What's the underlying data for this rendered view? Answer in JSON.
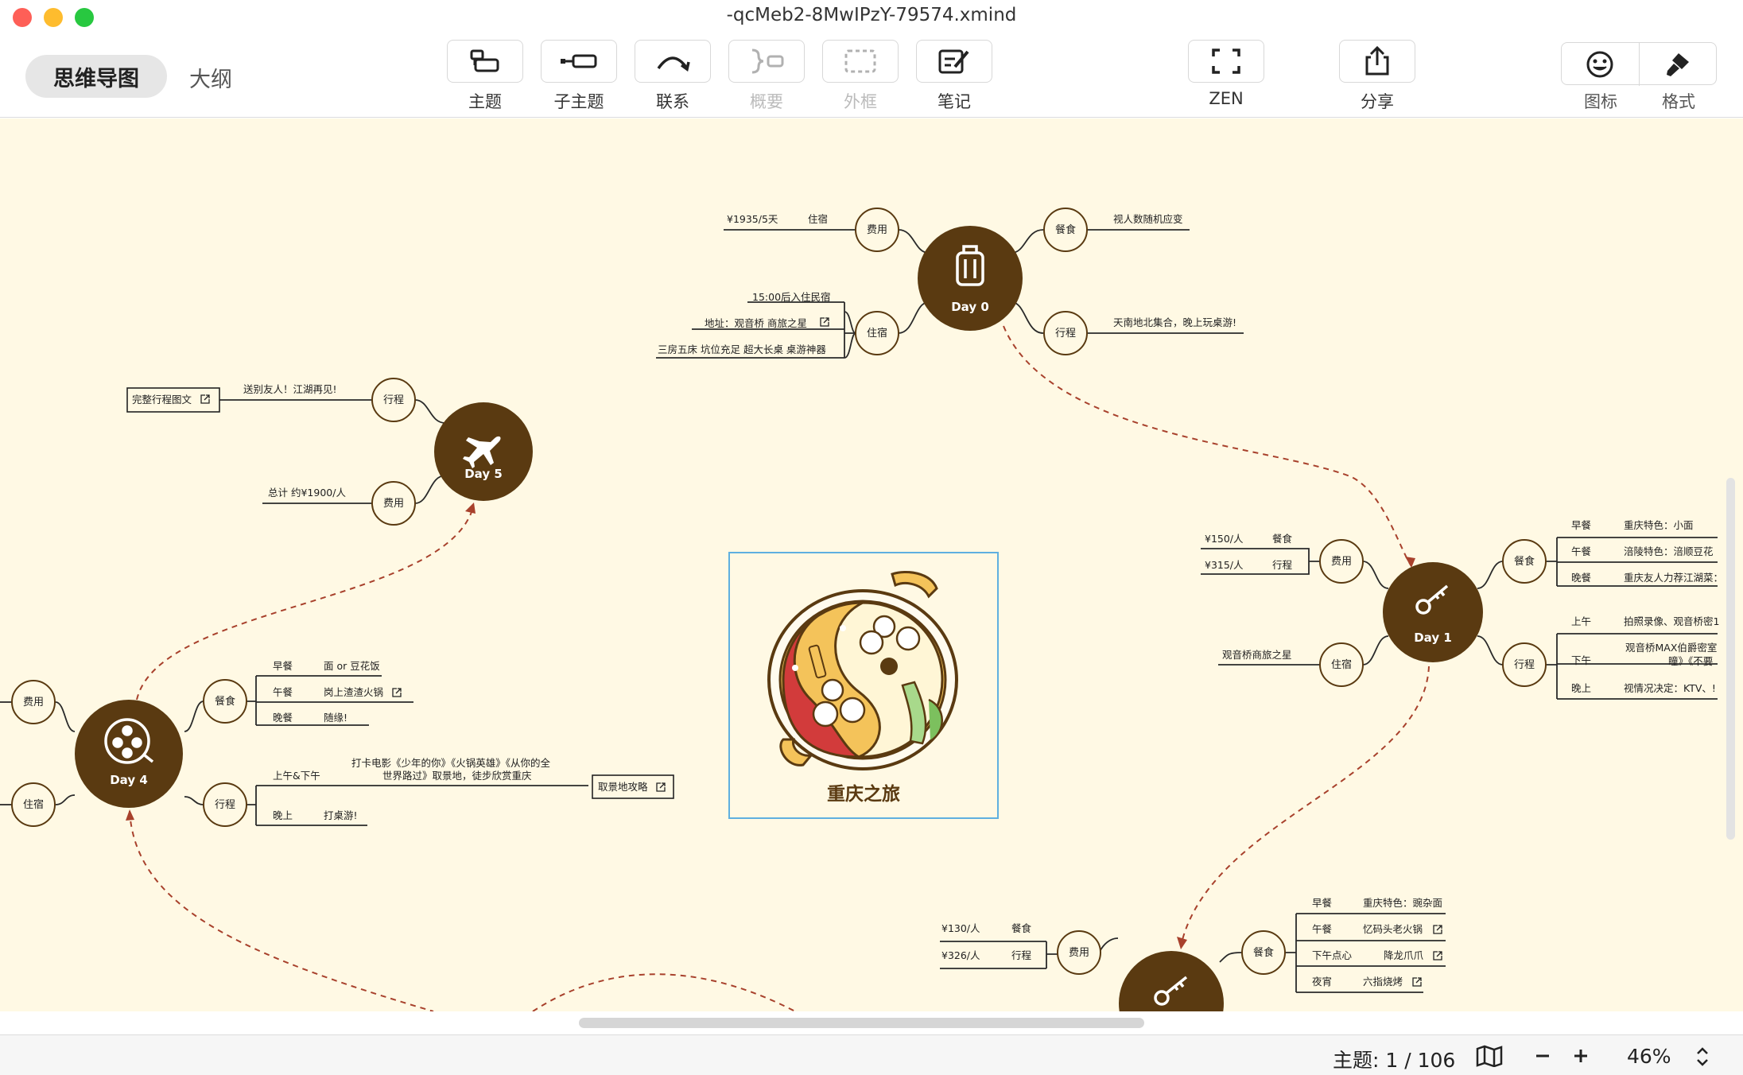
{
  "window": {
    "title": "-qcMeb2-8MwIPzY-79574.xmind"
  },
  "view_switch": {
    "mindmap": "思维导图",
    "outline": "大纲"
  },
  "toolbar": {
    "topic": "主题",
    "subtopic": "子主题",
    "relation": "联系",
    "summary": "概要",
    "boundary": "外框",
    "note": "笔记",
    "zen": "ZEN",
    "share": "分享",
    "icon": "图标",
    "format": "格式"
  },
  "central": {
    "title": "重庆之旅"
  },
  "days": {
    "d0": "Day 0",
    "d1": "Day 1",
    "d4": "Day 4",
    "d5": "Day 5"
  },
  "branches": {
    "fee": "费用",
    "food": "餐食",
    "trip": "行程",
    "stay": "住宿",
    "breakfast": "早餐",
    "lunch": "午餐",
    "dinner": "晚餐",
    "morning": "上午",
    "afternoon": "下午",
    "evening": "晚上",
    "am_pm": "上午&下午",
    "tea": "下午点心",
    "night": "夜宵"
  },
  "day0": {
    "fee_value": "¥1935/5天",
    "fee_item": "住宿",
    "stay1": "15:00后入住民宿",
    "stay2": "地址：观音桥 商旅之星",
    "stay3": "三房五床 坑位充足 超大长桌 桌游神器",
    "food": "视人数随机应变",
    "trip": "天南地北集合，晚上玩桌游!"
  },
  "day1": {
    "fee_food": "¥150/人",
    "fee_trip": "¥315/人",
    "stay": "观音桥商旅之星",
    "breakfast": "重庆特色：小面",
    "lunch": "涪陵特色：涪顺豆花",
    "dinner": "重庆友人力荐江湖菜：",
    "morning": "拍照录像、观音桥密1",
    "afternoon1": "观音桥MAX伯爵密室",
    "afternoon2": "瞳》《不要",
    "evening": "视情况决定：KTV、!"
  },
  "day2": {
    "fee_food": "¥130/人",
    "fee_trip": "¥326/人",
    "breakfast": "重庆特色：豌杂面",
    "lunch": "忆码头老火锅",
    "tea": "降龙爪爪",
    "night": "六指烧烤"
  },
  "day4": {
    "breakfast": "面 or 豆花饭",
    "lunch": "岗上渣渣火锅",
    "dinner": "随缘!",
    "am_pm1": "打卡电影《少年的你》《火锅英雄》《从你的全",
    "am_pm2": "世界路过》取景地，徒步欣赏重庆",
    "guide": "取景地攻略",
    "evening": "打桌游!"
  },
  "day5": {
    "trip": "送别友人！江湖再见!",
    "full": "完整行程图文",
    "fee": "总计 约¥1900/人"
  },
  "status": {
    "topic_count": "主题: 1 / 106",
    "zoom": "46%"
  },
  "colors": {
    "node": "#5a3a11",
    "canvas": "#fff9e4",
    "line": "#2a2a2a",
    "relation": "#b3402a"
  }
}
